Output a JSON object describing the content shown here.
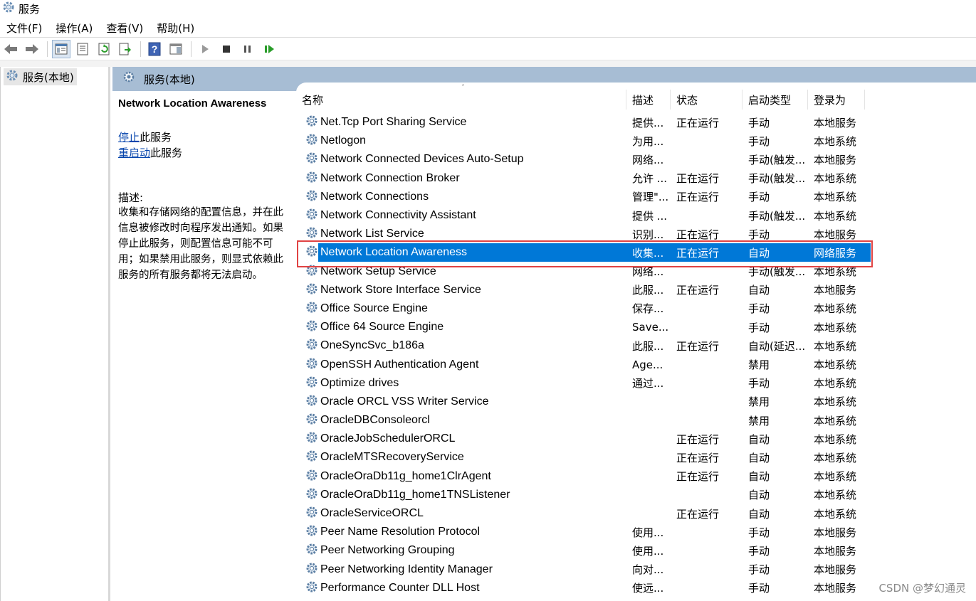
{
  "window": {
    "title": "服务"
  },
  "menu": [
    "文件(F)",
    "操作(A)",
    "查看(V)",
    "帮助(H)"
  ],
  "toolbar": {
    "icons": [
      "back-icon",
      "forward-icon",
      "show-hide-console-tree-icon",
      "properties-icon",
      "refresh-icon",
      "export-list-icon",
      "help-icon",
      "show-hide-action-pane-icon",
      "start-service-icon",
      "stop-service-icon",
      "pause-service-icon",
      "restart-service-icon"
    ]
  },
  "tree": {
    "root_label": "服务(本地)"
  },
  "pane": {
    "header": "服务(本地)"
  },
  "detail": {
    "service_name": "Network Location Awareness",
    "stop_link": "停止",
    "stop_suffix": "此服务",
    "restart_link": "重启动",
    "restart_suffix": "此服务",
    "desc_label": "描述:",
    "desc_lines": [
      "收集和存储网络的配置信息，并在此",
      "信息被修改时向程序发出通知。如果",
      "停止此服务，则配置信息可能不可",
      "用；如果禁用此服务，则显式依赖此",
      "服务的所有服务都将无法启动。"
    ]
  },
  "columns": {
    "name": "名称",
    "desc": "描述",
    "status": "状态",
    "startup": "启动类型",
    "logon": "登录为"
  },
  "services": [
    {
      "name": "Net.Tcp Port Sharing Service",
      "desc": "提供...",
      "status": "正在运行",
      "startup": "手动",
      "logon": "本地服务"
    },
    {
      "name": "Netlogon",
      "desc": "为用...",
      "status": "",
      "startup": "手动",
      "logon": "本地系统"
    },
    {
      "name": "Network Connected Devices Auto-Setup",
      "desc": "网络...",
      "status": "",
      "startup": "手动(触发...",
      "logon": "本地服务"
    },
    {
      "name": "Network Connection Broker",
      "desc": "允许 ...",
      "status": "正在运行",
      "startup": "手动(触发...",
      "logon": "本地系统"
    },
    {
      "name": "Network Connections",
      "desc": "管理\"...",
      "status": "正在运行",
      "startup": "手动",
      "logon": "本地系统"
    },
    {
      "name": "Network Connectivity Assistant",
      "desc": "提供 ...",
      "status": "",
      "startup": "手动(触发...",
      "logon": "本地系统"
    },
    {
      "name": "Network List Service",
      "desc": "识别...",
      "status": "正在运行",
      "startup": "手动",
      "logon": "本地服务"
    },
    {
      "name": "Network Location Awareness",
      "desc": "收集...",
      "status": "正在运行",
      "startup": "自动",
      "logon": "网络服务",
      "selected": true
    },
    {
      "name": "Network Setup Service",
      "desc": "网络...",
      "status": "",
      "startup": "手动(触发...",
      "logon": "本地系统"
    },
    {
      "name": "Network Store Interface Service",
      "desc": "此服...",
      "status": "正在运行",
      "startup": "自动",
      "logon": "本地服务"
    },
    {
      "name": "Office  Source Engine",
      "desc": "保存...",
      "status": "",
      "startup": "手动",
      "logon": "本地系统"
    },
    {
      "name": "Office 64 Source Engine",
      "desc": "Save...",
      "status": "",
      "startup": "手动",
      "logon": "本地系统"
    },
    {
      "name": "OneSyncSvc_b186a",
      "desc": "此服...",
      "status": "正在运行",
      "startup": "自动(延迟...",
      "logon": "本地系统"
    },
    {
      "name": "OpenSSH Authentication Agent",
      "desc": "Age...",
      "status": "",
      "startup": "禁用",
      "logon": "本地系统"
    },
    {
      "name": "Optimize drives",
      "desc": "通过...",
      "status": "",
      "startup": "手动",
      "logon": "本地系统"
    },
    {
      "name": "Oracle ORCL VSS Writer Service",
      "desc": "",
      "status": "",
      "startup": "禁用",
      "logon": "本地系统"
    },
    {
      "name": "OracleDBConsoleorcl",
      "desc": "",
      "status": "",
      "startup": "禁用",
      "logon": "本地系统"
    },
    {
      "name": "OracleJobSchedulerORCL",
      "desc": "",
      "status": "正在运行",
      "startup": "自动",
      "logon": "本地系统"
    },
    {
      "name": "OracleMTSRecoveryService",
      "desc": "",
      "status": "正在运行",
      "startup": "自动",
      "logon": "本地系统"
    },
    {
      "name": "OracleOraDb11g_home1ClrAgent",
      "desc": "",
      "status": "正在运行",
      "startup": "自动",
      "logon": "本地系统"
    },
    {
      "name": "OracleOraDb11g_home1TNSListener",
      "desc": "",
      "status": "",
      "startup": "自动",
      "logon": "本地系统"
    },
    {
      "name": "OracleServiceORCL",
      "desc": "",
      "status": "正在运行",
      "startup": "自动",
      "logon": "本地系统"
    },
    {
      "name": "Peer Name Resolution Protocol",
      "desc": "使用...",
      "status": "",
      "startup": "手动",
      "logon": "本地服务"
    },
    {
      "name": "Peer Networking Grouping",
      "desc": "使用...",
      "status": "",
      "startup": "手动",
      "logon": "本地服务"
    },
    {
      "name": "Peer Networking Identity Manager",
      "desc": "向对...",
      "status": "",
      "startup": "手动",
      "logon": "本地服务"
    },
    {
      "name": "Performance Counter DLL Host",
      "desc": "使远...",
      "status": "",
      "startup": "手动",
      "logon": "本地服务"
    }
  ],
  "watermark": "CSDN @梦幻通灵",
  "colors": {
    "selection": "#0078d7",
    "pane_header": "#a7bdd4",
    "highlight_box": "#e04343"
  }
}
